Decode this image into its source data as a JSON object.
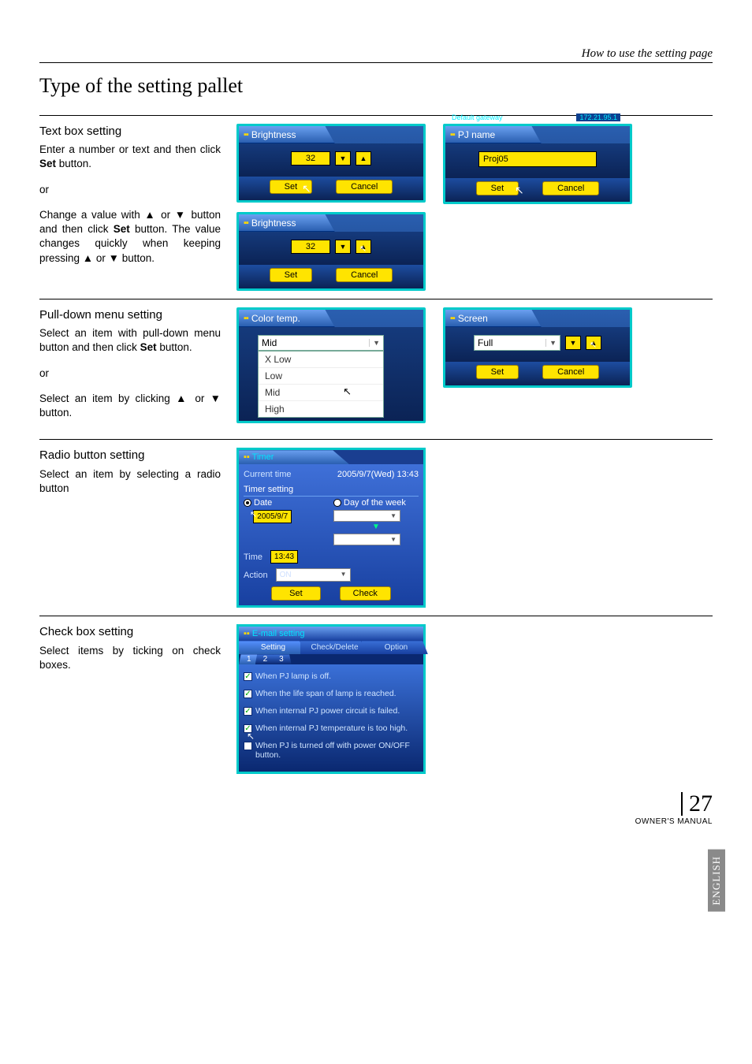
{
  "header_label": "How to use the setting page",
  "page_title": "Type of the setting pallet",
  "sections": {
    "textbox": {
      "heading": "Text box setting",
      "p1a": "Enter a number or text and then click ",
      "p1b": " button.",
      "or": "or",
      "p2a": "Change a value with ▲ or ▼ button and then click ",
      "p2b": " button.",
      "p3": "The value changes quickly when keeping pressing ▲ or ▼ button.",
      "set_word": "Set"
    },
    "pulldown": {
      "heading": "Pull-down menu setting",
      "p1a": "Select an item with pull-down menu button and then click ",
      "p1b": " button.",
      "or": "or",
      "p2": "Select an item by clicking ▲ or ▼ button.",
      "set_word": "Set"
    },
    "radio": {
      "heading": "Radio button setting",
      "p1": "Select an item by selecting a radio button"
    },
    "checkbox": {
      "heading": "Check box setting",
      "p1": "Select items by ticking on check boxes."
    }
  },
  "panels": {
    "brightness1": {
      "title": "Brightness",
      "value": "32",
      "set": "Set",
      "cancel": "Cancel"
    },
    "brightness2": {
      "title": "Brightness",
      "value": "32",
      "set": "Set",
      "cancel": "Cancel"
    },
    "pjname": {
      "title": "PJ name",
      "value": "Proj05",
      "set": "Set",
      "cancel": "Cancel",
      "gateway_label": "Default gateway",
      "gateway_value": "172.21.95.1"
    },
    "colortemp": {
      "title": "Color temp.",
      "selected": "Mid",
      "options": [
        "X Low",
        "Low",
        "Mid",
        "High"
      ]
    },
    "screen": {
      "title": "Screen",
      "selected": "Full",
      "set": "Set",
      "cancel": "Cancel"
    },
    "timer": {
      "title": "Timer",
      "current_label": "Current time",
      "current_value": "2005/9/7(Wed) 13:43",
      "setting_label": "Timer setting",
      "radio_date": "Date",
      "radio_dow": "Day of the week",
      "date_value": "2005/9/7",
      "time_label": "Time",
      "time_value": "13:43",
      "action_label": "Action",
      "action_value": "ON",
      "set": "Set",
      "check": "Check"
    },
    "email": {
      "title": "E-mail setting",
      "tabs": [
        "Setting",
        "Check/Delete",
        "Option"
      ],
      "numtabs": [
        "1",
        "2",
        "3"
      ],
      "items": [
        "When PJ lamp is off.",
        "When the life span of lamp is reached.",
        "When internal PJ power circuit is failed.",
        "When internal PJ temperature is too high.",
        "When PJ is turned off with power ON/OFF button."
      ]
    }
  },
  "side_tab": "ENGLISH",
  "page_number": "27",
  "owners_manual": "OWNER'S MANUAL"
}
